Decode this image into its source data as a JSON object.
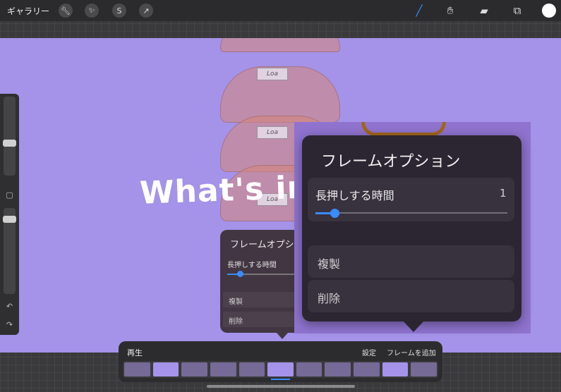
{
  "topbar": {
    "gallery_label": "ギャラリー",
    "left_tools": [
      "wrench-icon",
      "wand-icon",
      "selection-icon",
      "transform-icon"
    ],
    "right_tools": [
      "brush-icon",
      "smudge-icon",
      "eraser-icon",
      "layers-icon"
    ],
    "color": "#ffffff",
    "accent": "#3a8bff"
  },
  "canvas": {
    "background": "#a493e8",
    "handwritten_text": "What's in i",
    "bag_tag_text": "Loa"
  },
  "frame_options_small": {
    "title": "フレームオプシ",
    "hold_label": "長押しする時間",
    "duplicate_label": "複製",
    "delete_label": "削除"
  },
  "frame_options_large": {
    "title": "フレームオプション",
    "hold_label": "長押しする時間",
    "hold_value": "1",
    "duplicate_label": "複製",
    "delete_label": "削除"
  },
  "timeline": {
    "play_label": "再生",
    "settings_label": "設定",
    "add_frame_label": "フレームを追加",
    "active_frames": [
      1,
      5,
      9
    ]
  }
}
